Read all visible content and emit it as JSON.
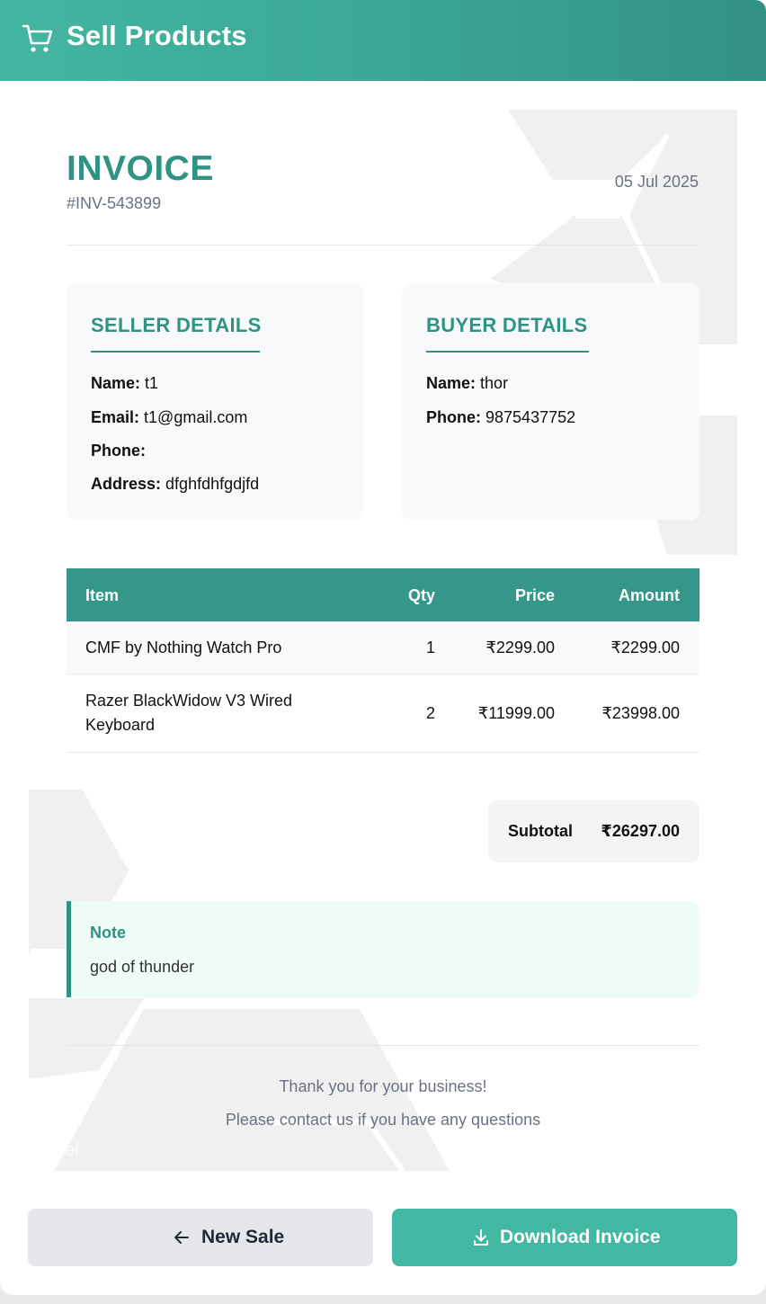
{
  "header": {
    "title": "Sell Products",
    "icon": "cart-icon"
  },
  "invoice": {
    "title": "INVOICE",
    "number": "#INV-543899",
    "date": "05 Jul 2025"
  },
  "seller": {
    "heading": "SELLER DETAILS",
    "name_label": "Name:",
    "name": "t1",
    "email_label": "Email:",
    "email": "t1@gmail.com",
    "phone_label": "Phone:",
    "phone": "",
    "address_label": "Address:",
    "address": "dfghfdhfgdjfd"
  },
  "buyer": {
    "heading": "BUYER DETAILS",
    "name_label": "Name:",
    "name": "thor",
    "phone_label": "Phone:",
    "phone": "9875437752"
  },
  "table": {
    "headers": {
      "item": "Item",
      "qty": "Qty",
      "price": "Price",
      "amount": "Amount"
    },
    "rows": [
      {
        "item": "CMF by Nothing Watch Pro",
        "qty": "1",
        "price": "₹2299.00",
        "amount": "₹2299.00"
      },
      {
        "item_line1": "Razer BlackWidow V3 Wired",
        "item_line2": "Keyboard",
        "qty": "2",
        "price": "₹11999.00",
        "amount": "₹23998.00"
      }
    ]
  },
  "subtotal": {
    "label": "Subtotal",
    "value": "₹26297.00"
  },
  "note": {
    "label": "Note",
    "text": "god of thunder"
  },
  "footer": {
    "line1": "Thank you for your business!",
    "line2": "Please contact us if you have any questions",
    "watermark": "wpixel"
  },
  "buttons": {
    "new_sale": "New Sale",
    "download": "Download Invoice"
  },
  "colors": {
    "accent": "#2f9384",
    "header": "#3aa595",
    "download_button": "#42b7a2"
  }
}
